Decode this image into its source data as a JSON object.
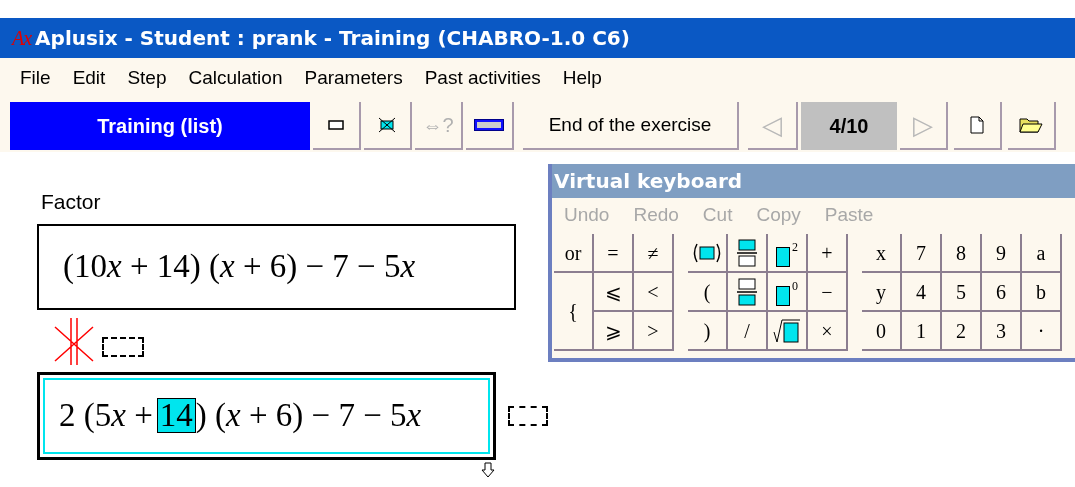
{
  "window": {
    "logo": "Ax",
    "title": "Aplusix - Student : prank - Training (CHABRO-1.0 C6)"
  },
  "menu": [
    "File",
    "Edit",
    "Step",
    "Calculation",
    "Parameters",
    "Past activities",
    "Help"
  ],
  "toolbar": {
    "mode": "Training (list)",
    "tools": [
      {
        "kind": "box",
        "disabled": false
      },
      {
        "kind": "crossed",
        "disabled": false
      },
      {
        "kind": "text",
        "label": "⇔?",
        "disabled": true
      },
      {
        "kind": "keyboard",
        "disabled": false
      }
    ],
    "end_button": "End of the exercise",
    "prev": {
      "label": "◁",
      "disabled": true
    },
    "counter": "4/10",
    "next": {
      "label": "▷",
      "disabled": true
    },
    "files": [
      {
        "kind": "new"
      },
      {
        "kind": "open"
      }
    ]
  },
  "exercise": {
    "instruction": "Factor",
    "given": [
      {
        "kind": "num",
        "text": "(10"
      },
      {
        "kind": "var",
        "text": "x"
      },
      {
        "kind": "num",
        "text": " + 14) ("
      },
      {
        "kind": "var",
        "text": "x"
      },
      {
        "kind": "num",
        "text": " + 6) − 7 − 5"
      },
      {
        "kind": "var",
        "text": "x"
      }
    ],
    "equivalent": false,
    "answer": {
      "before": [
        {
          "kind": "num",
          "text": "2 (5"
        },
        {
          "kind": "var",
          "text": "x"
        },
        {
          "kind": "num",
          "text": " +"
        }
      ],
      "selected": "14",
      "after": [
        {
          "kind": "num",
          "text": ") ("
        },
        {
          "kind": "var",
          "text": "x"
        },
        {
          "kind": "num",
          "text": " + 6) − 7 − 5"
        },
        {
          "kind": "var",
          "text": "x"
        }
      ]
    }
  },
  "keyboard": {
    "title": "Virtual keyboard",
    "menu": [
      {
        "label": "Undo",
        "disabled": true
      },
      {
        "label": "Redo",
        "disabled": true
      },
      {
        "label": "Cut",
        "disabled": true
      },
      {
        "label": "Copy",
        "disabled": true
      },
      {
        "label": "Paste",
        "disabled": true
      }
    ],
    "groups": [
      {
        "keys": [
          {
            "kind": "text",
            "label": "or"
          },
          {
            "kind": "text",
            "label": "="
          },
          {
            "kind": "text",
            "label": "≠"
          },
          {
            "kind": "text",
            "label": "{",
            "tall": true
          },
          {
            "kind": "text",
            "label": "⩽"
          },
          {
            "kind": "text",
            "label": "<"
          },
          {
            "kind": "text",
            "label": "⩾"
          },
          {
            "kind": "text",
            "label": ">"
          }
        ]
      },
      {
        "keys": [
          {
            "kind": "paren-box"
          },
          {
            "kind": "fraction-top"
          },
          {
            "kind": "power",
            "label": "2"
          },
          {
            "kind": "text",
            "label": "+"
          },
          {
            "kind": "text",
            "label": "("
          },
          {
            "kind": "fraction-bottom"
          },
          {
            "kind": "power",
            "label": "0"
          },
          {
            "kind": "text",
            "label": "−"
          },
          {
            "kind": "text",
            "label": ")"
          },
          {
            "kind": "text",
            "label": "/"
          },
          {
            "kind": "root"
          },
          {
            "kind": "text",
            "label": "×"
          }
        ]
      },
      {
        "keys": [
          {
            "kind": "text",
            "label": "x"
          },
          {
            "kind": "text",
            "label": "7"
          },
          {
            "kind": "text",
            "label": "8"
          },
          {
            "kind": "text",
            "label": "9"
          },
          {
            "kind": "text",
            "label": "a"
          },
          {
            "kind": "text",
            "label": "y"
          },
          {
            "kind": "text",
            "label": "4"
          },
          {
            "kind": "text",
            "label": "5"
          },
          {
            "kind": "text",
            "label": "6"
          },
          {
            "kind": "text",
            "label": "b"
          },
          {
            "kind": "text",
            "label": "0"
          },
          {
            "kind": "text",
            "label": "1"
          },
          {
            "kind": "text",
            "label": "2"
          },
          {
            "kind": "text",
            "label": "3"
          },
          {
            "kind": "text",
            "label": "·"
          }
        ]
      }
    ]
  }
}
